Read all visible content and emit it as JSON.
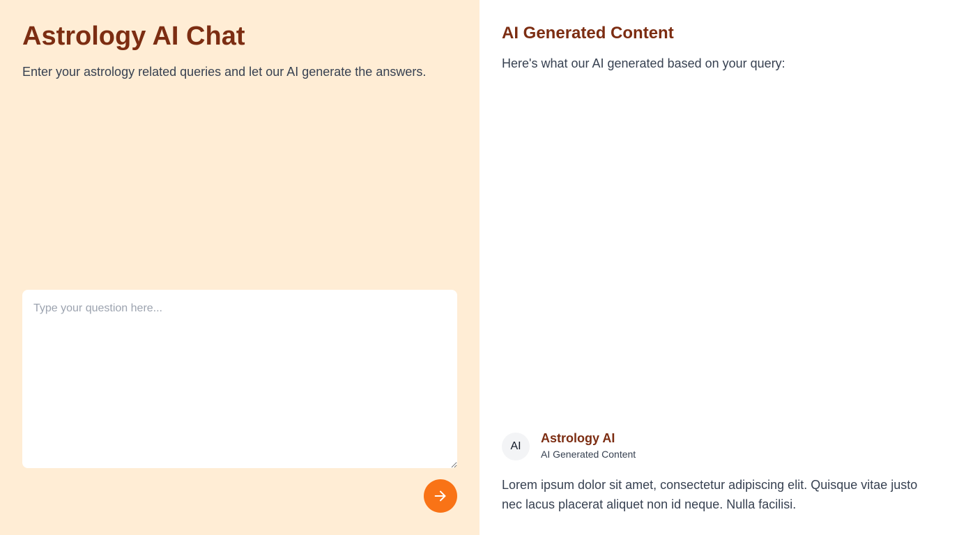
{
  "left_panel": {
    "title": "Astrology AI Chat",
    "subtitle": "Enter your astrology related queries and let our AI generate the answers.",
    "input": {
      "placeholder": "Type your question here...",
      "value": ""
    },
    "send_button": {
      "icon": "arrow-right-icon"
    }
  },
  "right_panel": {
    "title": "AI Generated Content",
    "intro": "Here's what our AI generated based on your query:",
    "message": {
      "avatar_text": "AI",
      "sender_name": "Astrology AI",
      "sender_meta": "AI Generated Content",
      "body": "Lorem ipsum dolor sit amet, consectetur adipiscing elit. Quisque vitae justo nec lacus placerat aliquet non id neque. Nulla facilisi."
    }
  },
  "colors": {
    "left_background": "#ffedd5",
    "title_color": "#7c2d12",
    "accent": "#f97316",
    "text": "#374151"
  }
}
